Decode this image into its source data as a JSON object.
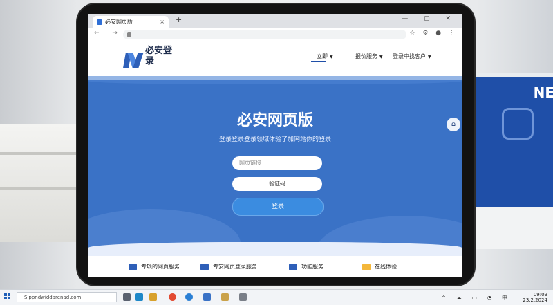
{
  "browser": {
    "tab_title": "必安网页版",
    "tab_close": "×",
    "new_tab": "+",
    "window_controls": "— ▢ ✕",
    "nav_controls": "← → ⟳",
    "extensions": "☆ ⚙ ● ⋮"
  },
  "site": {
    "logo_text": "必安登录",
    "menu": [
      {
        "label": "立即"
      },
      {
        "label": "报价服务"
      },
      {
        "label": "登录中找客户"
      }
    ],
    "hero_title": "必安网页版",
    "hero_subtitle": "登录登录登录领域体验了加网站你的登录",
    "username_placeholder": "网页链接",
    "verify_label": "验证码",
    "login_button": "登录",
    "home_icon": "⌂",
    "features": [
      {
        "label": "专项的网页服务",
        "icon": "blue"
      },
      {
        "label": "专安网页登录服务",
        "icon": "blue"
      },
      {
        "label": "功能服务",
        "icon": "blue"
      },
      {
        "label": "在线体验",
        "icon": "yellow"
      }
    ]
  },
  "background": {
    "monitor_text": "NE"
  },
  "taskbar": {
    "search_text": "Sippndwiddarenad.com",
    "tray_icons": "^ ☁ ▭ ◔ 中",
    "time": "09:09",
    "date": "23.2.2024"
  }
}
